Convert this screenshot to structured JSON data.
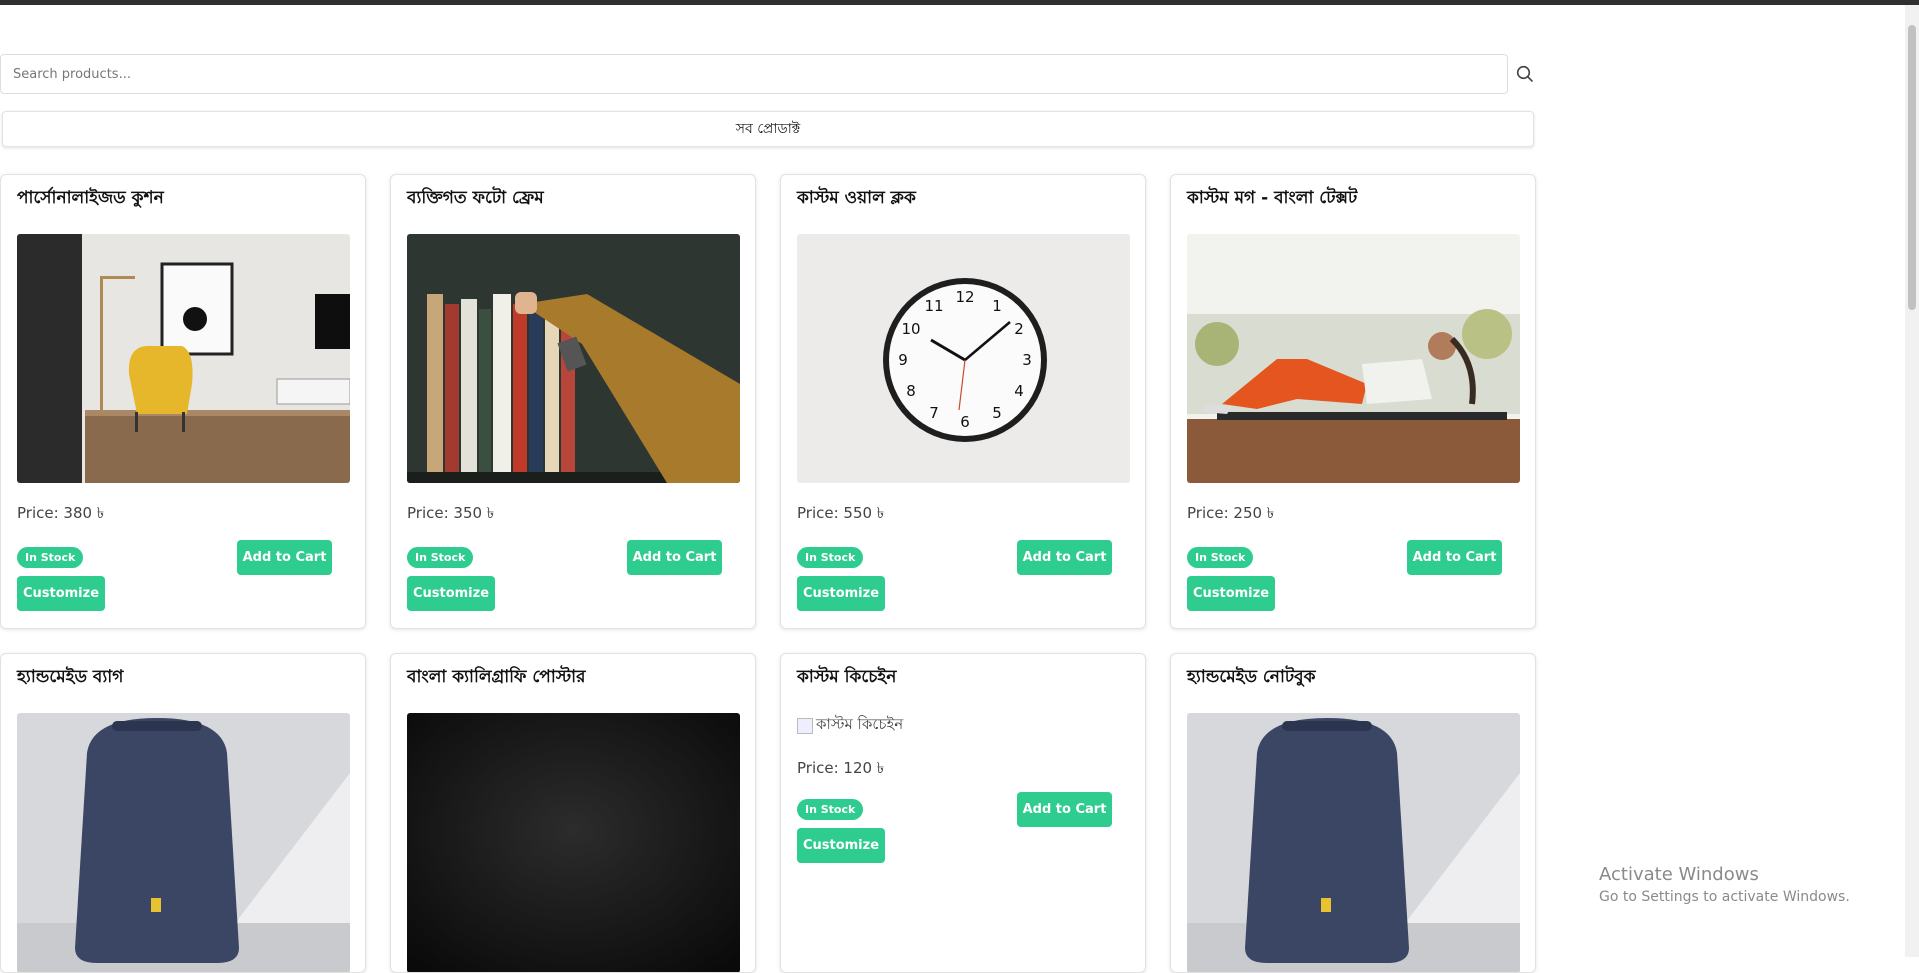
{
  "search": {
    "placeholder": "Search products..."
  },
  "category": {
    "label": "সব প্রোডাক্ট"
  },
  "products": [
    {
      "title": "পার্সোনালাইজড কুশন",
      "price": "Price: 380 ৳",
      "stock": "In Stock",
      "add": "Add to Cart",
      "customize": "Customize",
      "image": "yellow-armchair-living-room"
    },
    {
      "title": "ব্যক্তিগত ফটো ফ্রেম",
      "price": "Price: 350 ৳",
      "stock": "In Stock",
      "add": "Add to Cart",
      "customize": "Customize",
      "image": "hand-picking-book-from-shelf"
    },
    {
      "title": "কাস্টম ওয়াল ক্লক",
      "price": "Price: 550 ৳",
      "stock": "In Stock",
      "add": "Add to Cart",
      "customize": "Customize",
      "image": "white-wall-clock"
    },
    {
      "title": "কাস্টম মগ - বাংলা টেক্সট",
      "price": "Price: 250 ৳",
      "stock": "In Stock",
      "add": "Add to Cart",
      "customize": "Customize",
      "image": "woman-doing-situps"
    },
    {
      "title": "হ্যান্ডমেইড ব্যাগ",
      "image": "navy-backpack"
    },
    {
      "title": "বাংলা ক্যালিগ্রাফি পোস্টার",
      "image": "dark-texture"
    },
    {
      "title": "কাস্টম কিচেইন",
      "alt": "কাস্টম কিচেইন",
      "price": "Price: 120 ৳",
      "stock": "In Stock",
      "add": "Add to Cart",
      "customize": "Customize"
    },
    {
      "title": "হ্যান্ডমেইড নোটবুক",
      "image": "navy-backpack"
    }
  ],
  "watermark": {
    "title": "Activate Windows",
    "subtitle": "Go to Settings to activate Windows."
  },
  "colors": {
    "accent": "#2ecc8f",
    "topbar": "#2f2f2f"
  }
}
